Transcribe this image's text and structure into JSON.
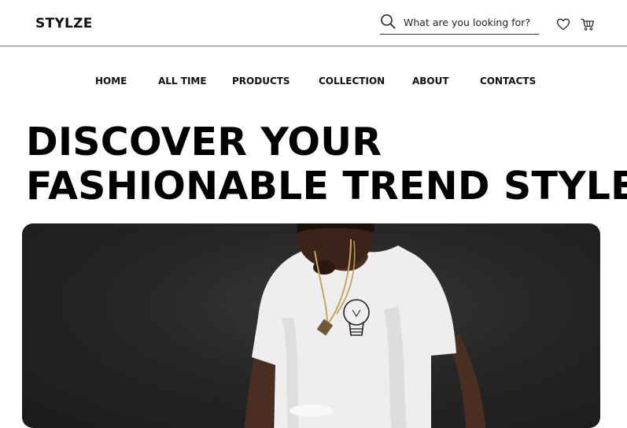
{
  "header": {
    "logo": "STYLZE",
    "search": {
      "placeholder": "What are you looking for?"
    },
    "icons": [
      "search-icon",
      "heart-icon",
      "cart-icon"
    ]
  },
  "nav": {
    "items": [
      {
        "label": "HOME"
      },
      {
        "label": "ALL TIME"
      },
      {
        "label": "PRODUCTS"
      },
      {
        "label": "COLLECTION"
      },
      {
        "label": "ABOUT"
      },
      {
        "label": "CONTACTS"
      }
    ]
  },
  "hero": {
    "title_line1": "DISCOVER YOUR",
    "title_line2": "FASHIONABLE TREND STYLE",
    "image": "model-in-white-tshirt-photo"
  },
  "colors": {
    "text": "#111111",
    "background": "#ffffff",
    "divider": "#6b6b6b",
    "photo_background": "#262626",
    "tshirt": "#f2f2f2"
  }
}
